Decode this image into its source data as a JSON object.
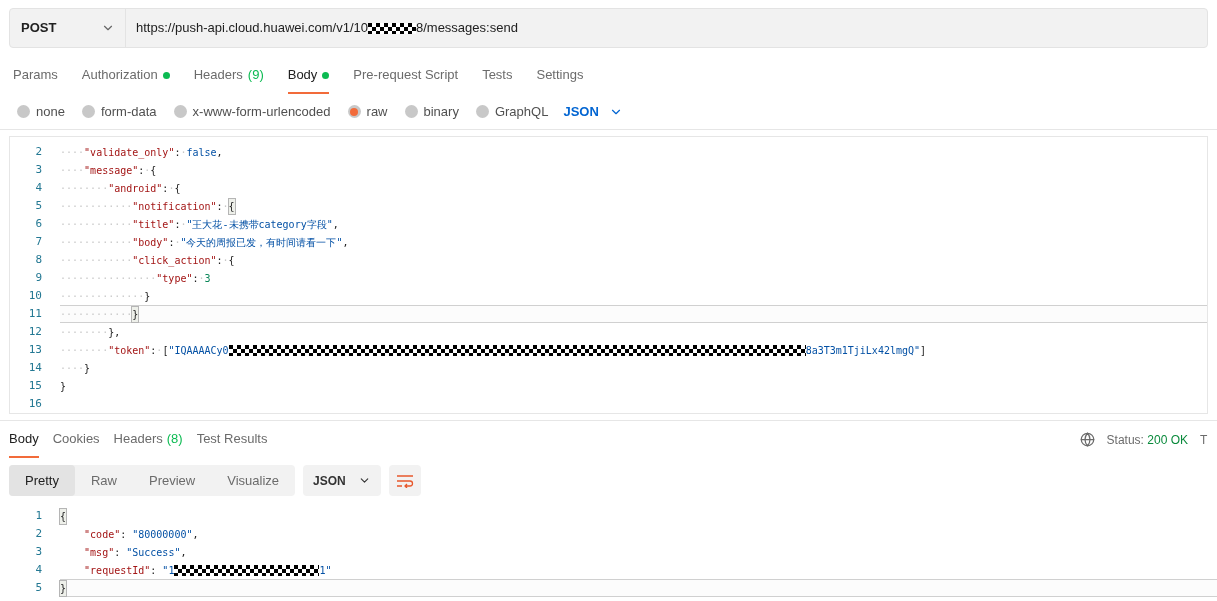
{
  "request": {
    "method": "POST",
    "url_parts": [
      {
        "kind": "text",
        "text": "https://push-api.cloud.huawei.com/v1/10"
      },
      {
        "kind": "blackout"
      },
      {
        "kind": "text",
        "text": "8/messages:send"
      }
    ]
  },
  "request_tabs": [
    {
      "label": "Params",
      "selected": false
    },
    {
      "label": "Authorization",
      "selected": false,
      "dot": true
    },
    {
      "label": "Headers",
      "count": "(9)",
      "selected": false
    },
    {
      "label": "Body",
      "selected": true,
      "dot": true
    },
    {
      "label": "Pre-request Script",
      "selected": false
    },
    {
      "label": "Tests",
      "selected": false
    },
    {
      "label": "Settings",
      "selected": false
    }
  ],
  "body_types": [
    {
      "label": "none",
      "selected": false
    },
    {
      "label": "form-data",
      "selected": false
    },
    {
      "label": "x-www-form-urlencoded",
      "selected": false
    },
    {
      "label": "raw",
      "selected": true
    },
    {
      "label": "binary",
      "selected": false
    },
    {
      "label": "GraphQL",
      "selected": false
    }
  ],
  "body_format": "JSON",
  "editor": {
    "lines": [
      {
        "number": "2",
        "current": false,
        "segments": [
          {
            "kind": "ws",
            "text": "····"
          },
          {
            "kind": "key",
            "text": "\"validate_only\""
          },
          {
            "kind": "punct",
            "text": ":"
          },
          {
            "kind": "ws",
            "text": "·"
          },
          {
            "kind": "literal",
            "text": "false"
          },
          {
            "kind": "punct",
            "text": ","
          }
        ]
      },
      {
        "number": "3",
        "current": false,
        "segments": [
          {
            "kind": "ws",
            "text": "····"
          },
          {
            "kind": "key",
            "text": "\"message\""
          },
          {
            "kind": "punct",
            "text": ":"
          },
          {
            "kind": "ws",
            "text": "·"
          },
          {
            "kind": "punct",
            "text": "{"
          }
        ]
      },
      {
        "number": "4",
        "current": false,
        "segments": [
          {
            "kind": "ws",
            "text": "········"
          },
          {
            "kind": "key",
            "text": "\"android\""
          },
          {
            "kind": "punct",
            "text": ":"
          },
          {
            "kind": "ws",
            "text": "·"
          },
          {
            "kind": "punct",
            "text": "{"
          }
        ]
      },
      {
        "number": "5",
        "current": false,
        "segments": [
          {
            "kind": "ws",
            "text": "············"
          },
          {
            "kind": "key",
            "text": "\"notification\""
          },
          {
            "kind": "punct",
            "text": ":"
          },
          {
            "kind": "ws",
            "text": "·"
          },
          {
            "kind": "match",
            "text": "{"
          }
        ]
      },
      {
        "number": "6",
        "current": false,
        "segments": [
          {
            "kind": "ws",
            "text": "············"
          },
          {
            "kind": "key",
            "text": "\"title\""
          },
          {
            "kind": "punct",
            "text": ":"
          },
          {
            "kind": "ws",
            "text": "·"
          },
          {
            "kind": "string",
            "text": "\"王大花-未携带category字段\""
          },
          {
            "kind": "punct",
            "text": ","
          }
        ]
      },
      {
        "number": "7",
        "current": false,
        "segments": [
          {
            "kind": "ws",
            "text": "············"
          },
          {
            "kind": "key",
            "text": "\"body\""
          },
          {
            "kind": "punct",
            "text": ":"
          },
          {
            "kind": "ws",
            "text": "·"
          },
          {
            "kind": "string",
            "text": "\"今天的周报已发，有时间请看一下\""
          },
          {
            "kind": "punct",
            "text": ","
          }
        ]
      },
      {
        "number": "8",
        "current": false,
        "segments": [
          {
            "kind": "ws",
            "text": "············"
          },
          {
            "kind": "key",
            "text": "\"click_action\""
          },
          {
            "kind": "punct",
            "text": ":"
          },
          {
            "kind": "ws",
            "text": "·"
          },
          {
            "kind": "punct",
            "text": "{"
          }
        ]
      },
      {
        "number": "9",
        "current": false,
        "segments": [
          {
            "kind": "ws",
            "text": "················"
          },
          {
            "kind": "key",
            "text": "\"type\""
          },
          {
            "kind": "punct",
            "text": ":"
          },
          {
            "kind": "ws",
            "text": "·"
          },
          {
            "kind": "number",
            "text": "3"
          }
        ]
      },
      {
        "number": "10",
        "current": false,
        "segments": [
          {
            "kind": "ws",
            "text": "··············"
          },
          {
            "kind": "punct",
            "text": "}"
          }
        ]
      },
      {
        "number": "11",
        "current": true,
        "segments": [
          {
            "kind": "ws",
            "text": "············"
          },
          {
            "kind": "match",
            "text": "}"
          }
        ]
      },
      {
        "number": "12",
        "current": false,
        "segments": [
          {
            "kind": "ws",
            "text": "········"
          },
          {
            "kind": "punct",
            "text": "},"
          }
        ]
      },
      {
        "number": "13",
        "current": false,
        "segments": [
          {
            "kind": "ws",
            "text": "········"
          },
          {
            "kind": "key",
            "text": "\"token\""
          },
          {
            "kind": "punct",
            "text": ":"
          },
          {
            "kind": "ws",
            "text": "·"
          },
          {
            "kind": "punct",
            "text": "["
          },
          {
            "kind": "string",
            "text": "\"IQAAAACy0"
          },
          {
            "kind": "redacted"
          },
          {
            "kind": "string",
            "text": "8a3T3m1TjiLx42lmgQ\""
          },
          {
            "kind": "punct",
            "text": "]"
          }
        ]
      },
      {
        "number": "14",
        "current": false,
        "segments": [
          {
            "kind": "ws",
            "text": "····"
          },
          {
            "kind": "punct",
            "text": "}"
          }
        ]
      },
      {
        "number": "15",
        "current": false,
        "segments": [
          {
            "kind": "punct",
            "text": "}"
          }
        ]
      },
      {
        "number": "16"
      }
    ]
  },
  "response_tabs": [
    {
      "label": "Body",
      "selected": true
    },
    {
      "label": "Cookies",
      "selected": false
    },
    {
      "label": "Headers",
      "count": "(8)",
      "selected": false
    },
    {
      "label": "Test Results",
      "selected": false
    }
  ],
  "status": {
    "label": "Status:",
    "value": "200 OK",
    "cut": "T"
  },
  "view_modes": [
    {
      "label": "Pretty",
      "selected": true
    },
    {
      "label": "Raw",
      "selected": false
    },
    {
      "label": "Preview",
      "selected": false
    },
    {
      "label": "Visualize",
      "selected": false
    }
  ],
  "response_format": "JSON",
  "response": {
    "lines": [
      {
        "number": "1",
        "current": false,
        "segments": [
          {
            "kind": "match",
            "text": "{"
          }
        ]
      },
      {
        "number": "2",
        "current": false,
        "segments": [
          {
            "kind": "indent"
          },
          {
            "kind": "key",
            "text": "\"code\""
          },
          {
            "kind": "punct",
            "text": ": "
          },
          {
            "kind": "string",
            "text": "\"80000000\""
          },
          {
            "kind": "punct",
            "text": ","
          }
        ]
      },
      {
        "number": "3",
        "current": false,
        "segments": [
          {
            "kind": "indent"
          },
          {
            "kind": "key",
            "text": "\"msg\""
          },
          {
            "kind": "punct",
            "text": ": "
          },
          {
            "kind": "string",
            "text": "\"Success\""
          },
          {
            "kind": "punct",
            "text": ","
          }
        ]
      },
      {
        "number": "4",
        "current": false,
        "segments": [
          {
            "kind": "indent"
          },
          {
            "kind": "key",
            "text": "\"requestId\""
          },
          {
            "kind": "punct",
            "text": ": "
          },
          {
            "kind": "string",
            "text": "\"1"
          },
          {
            "kind": "censored"
          },
          {
            "kind": "string",
            "text": "1\""
          }
        ]
      },
      {
        "number": "5",
        "current": true,
        "segments": [
          {
            "kind": "match",
            "text": "}"
          }
        ]
      }
    ]
  }
}
